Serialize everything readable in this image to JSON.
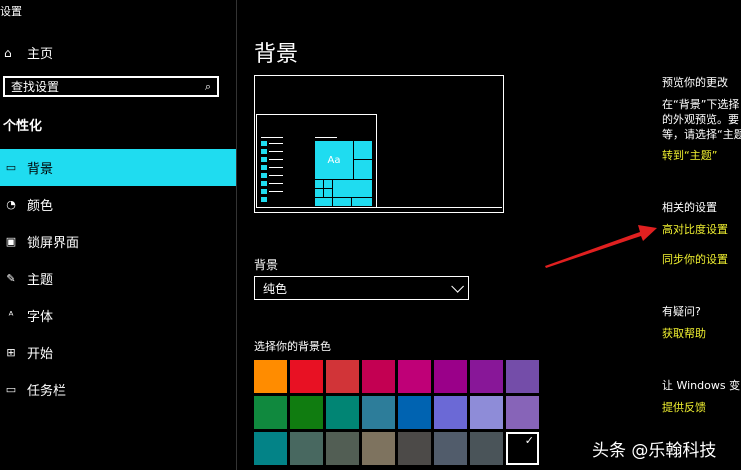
{
  "app_title": "设置",
  "home": {
    "label": "主页",
    "icon": "home-icon"
  },
  "search": {
    "placeholder": "查找设置",
    "icon": "search-icon"
  },
  "section_title": "个性化",
  "nav": [
    {
      "label": "背景",
      "icon": "background-icon",
      "active": true
    },
    {
      "label": "颜色",
      "icon": "palette-icon",
      "active": false
    },
    {
      "label": "锁屏界面",
      "icon": "lock-screen-icon",
      "active": false
    },
    {
      "label": "主题",
      "icon": "theme-icon",
      "active": false
    },
    {
      "label": "字体",
      "icon": "font-icon",
      "active": false
    },
    {
      "label": "开始",
      "icon": "start-icon",
      "active": false
    },
    {
      "label": "任务栏",
      "icon": "taskbar-icon",
      "active": false
    }
  ],
  "main": {
    "title": "背景",
    "preview_tile_text": "Aa",
    "background_label": "背景",
    "background_value": "纯色",
    "swatch_label": "选择你的背景色",
    "swatches": [
      "#ff8c00",
      "#e81123",
      "#d13438",
      "#c30052",
      "#bf0077",
      "#9a0089",
      "#881798",
      "#744da9",
      "#10893e",
      "#107c10",
      "#018574",
      "#2d7d9a",
      "#0063b1",
      "#6b69d6",
      "#8e8cd8",
      "#8764b8",
      "#038387",
      "#486860",
      "#525e54",
      "#7e735f",
      "#4c4a48",
      "#515c6b",
      "#4a5459",
      "#000000"
    ],
    "selected_swatch": 23
  },
  "right": {
    "preview_title": "预览你的更改",
    "preview_desc_1": "在“背景”下选择",
    "preview_desc_2": "的外观预览。要",
    "preview_desc_3": "等，请选择“主题",
    "goto_theme": "转到“主题”",
    "related_title": "相关的设置",
    "high_contrast": "高对比度设置",
    "sync": "同步你的设置",
    "question_title": "有疑问?",
    "get_help": "获取帮助",
    "improve_title": "让 Windows 变",
    "feedback": "提供反馈"
  },
  "watermark": "头条 @乐翰科技",
  "colors": {
    "accent": "#1fdcf0",
    "link": "#f0f030",
    "arrow": "#e02020"
  }
}
